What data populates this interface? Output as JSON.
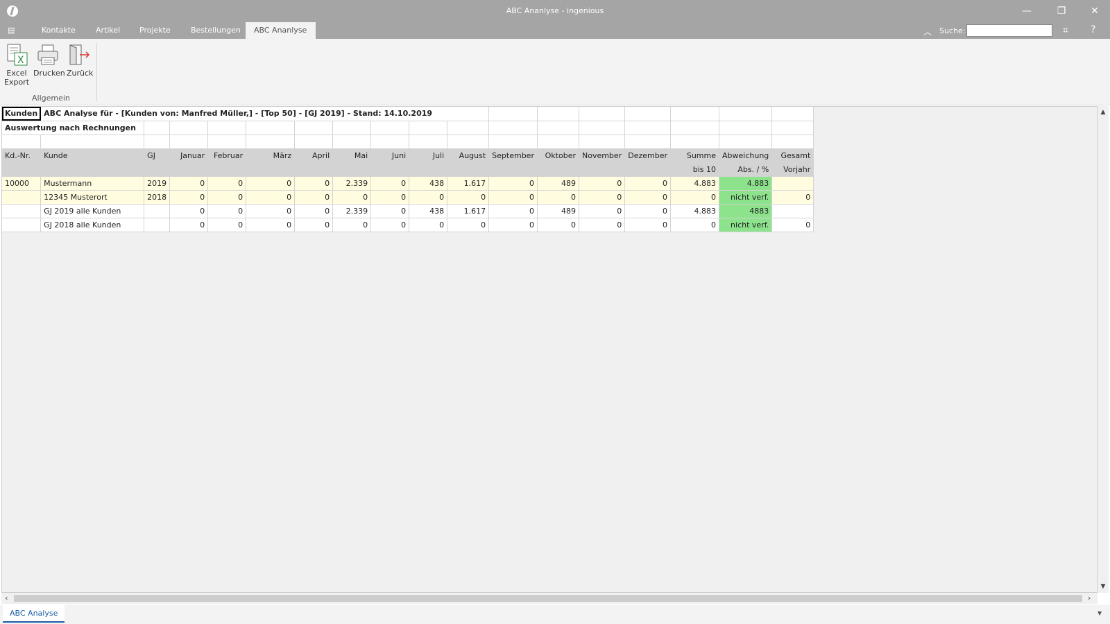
{
  "window": {
    "title": "ABC Ananlyse - ingenious",
    "min_glyph": "—",
    "restore_glyph": "❐",
    "close_glyph": "✕"
  },
  "menubar": {
    "menu_glyph": "▤",
    "tabs": [
      "Kontakte",
      "Artikel",
      "Projekte",
      "Bestellungen",
      "ABC Ananlyse"
    ],
    "active_tab": "ABC Ananlyse",
    "collapse_glyph": "︿",
    "search_label": "Suche:",
    "search_value": "",
    "binoculars_glyph": "⌗",
    "help_glyph": "?"
  },
  "ribbon": {
    "buttons": [
      {
        "label1": "Excel",
        "label2": "Export",
        "icon": "excel-export-icon"
      },
      {
        "label1": "Drucken",
        "label2": "",
        "icon": "printer-icon"
      },
      {
        "label1": "Zurück",
        "label2": "",
        "icon": "exit-door-icon"
      }
    ],
    "group_label": "Allgemein"
  },
  "grid": {
    "cell_a1": "Kunden",
    "title": "ABC Analyse für  - [Kunden von: Manfred Müller,] - [Top 50] - [GJ 2019] - Stand: 14.10.2019",
    "subtitle": "Auswertung nach Rechnungen",
    "headers": [
      "Kd.-Nr.",
      "Kunde",
      "GJ",
      "Januar",
      "Februar",
      "März",
      "April",
      "Mai",
      "Juni",
      "Juli",
      "August",
      "September",
      "Oktober",
      "November",
      "Dezember",
      "Summe",
      "Abweichung",
      "Gesamt"
    ],
    "headers2": [
      "",
      "",
      "",
      "",
      "",
      "",
      "",
      "",
      "",
      "",
      "",
      "",
      "",
      "",
      "",
      "bis 10",
      "Abs. / %",
      "Vorjahr"
    ],
    "rows": [
      {
        "cells": [
          "10000",
          "Mustermann",
          "2019",
          "0",
          "0",
          "0",
          "0",
          "2.339",
          "0",
          "438",
          "1.617",
          "0",
          "489",
          "0",
          "0",
          "4.883",
          "4.883",
          ""
        ],
        "yellow": true
      },
      {
        "cells": [
          "",
          "12345 Musterort",
          "2018",
          "0",
          "0",
          "0",
          "0",
          "0",
          "0",
          "0",
          "0",
          "0",
          "0",
          "0",
          "0",
          "0",
          "nicht verf.",
          "0"
        ],
        "yellow": true
      },
      {
        "cells": [
          "",
          "GJ 2019 alle Kunden",
          "",
          "0",
          "0",
          "0",
          "0",
          "2.339",
          "0",
          "438",
          "1.617",
          "0",
          "489",
          "0",
          "0",
          "4.883",
          "4883",
          ""
        ],
        "yellow": false
      },
      {
        "cells": [
          "",
          "GJ 2018 alle Kunden",
          "",
          "0",
          "0",
          "0",
          "0",
          "0",
          "0",
          "0",
          "0",
          "0",
          "0",
          "0",
          "0",
          "0",
          "nicht verf.",
          "0"
        ],
        "yellow": false
      }
    ]
  },
  "bottom": {
    "tab": "ABC Analyse"
  },
  "colors": {
    "titlebar": "#a5a5a5",
    "highlight_green": "#8ce38c",
    "row_yellow": "#fffce0",
    "active_blue": "#1b5ea7"
  }
}
